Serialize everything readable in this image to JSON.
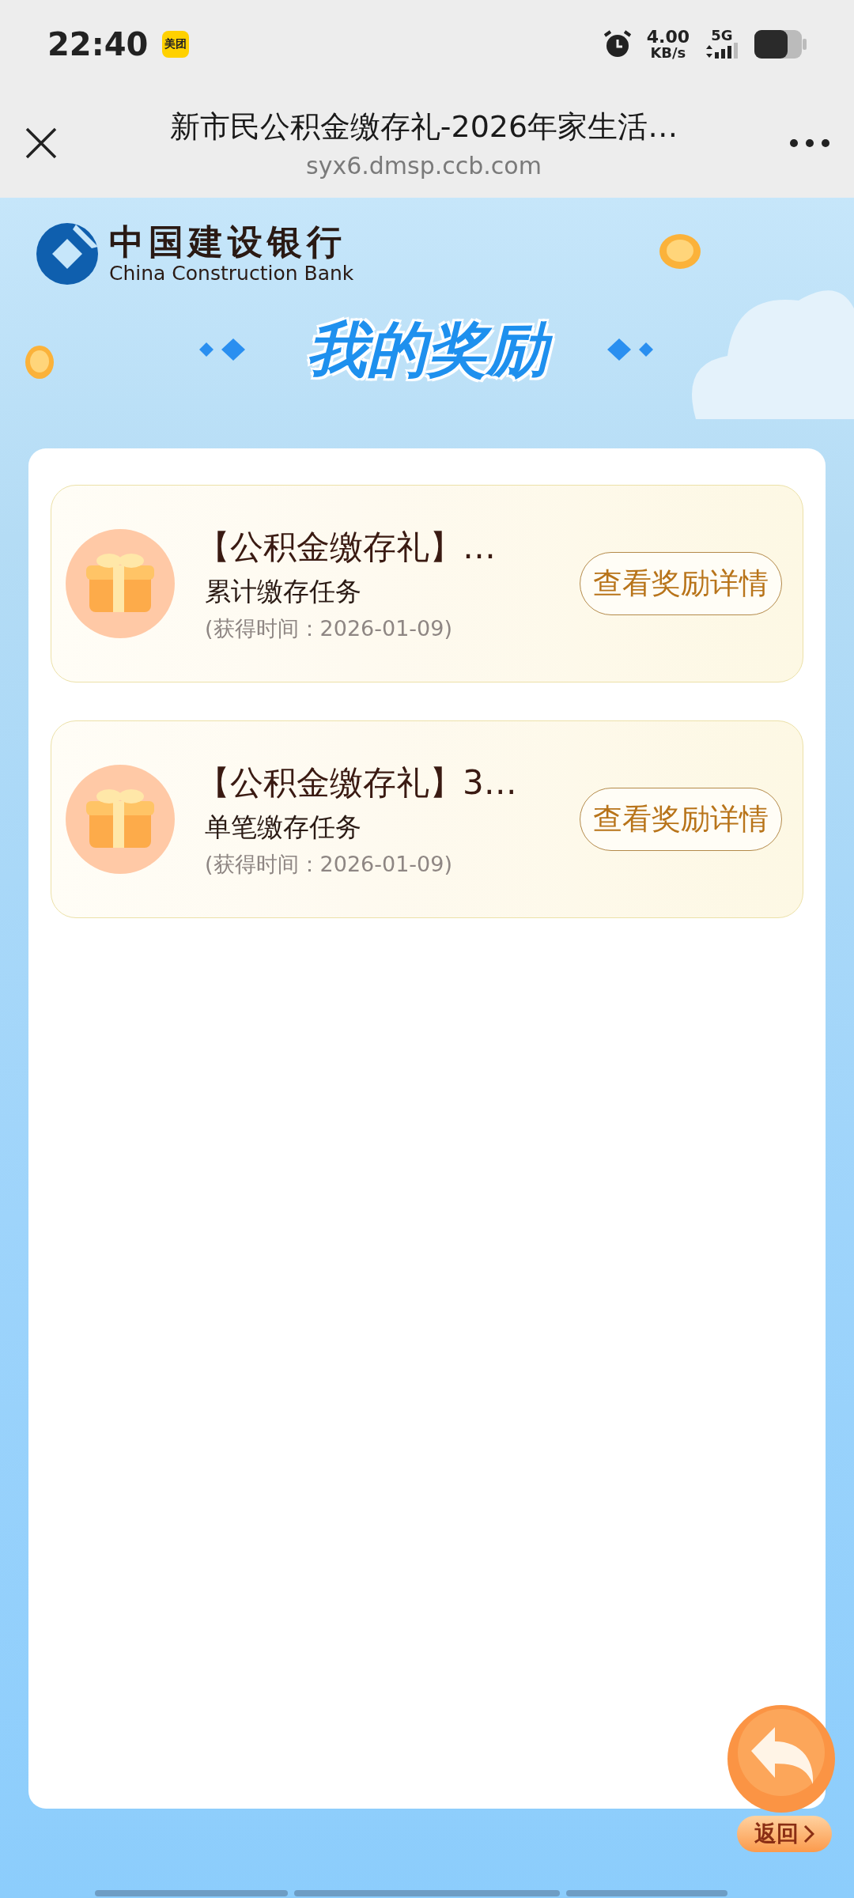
{
  "status_bar": {
    "time": "22:40",
    "app_badge": "美团",
    "speed_value": "4.00",
    "speed_unit": "KB/s",
    "network": "5G"
  },
  "browser_bar": {
    "title": "新市民公积金缴存礼-2026年家生活…",
    "url": "syx6.dmsp.ccb.com"
  },
  "brand": {
    "name_cn": "中国建设银行",
    "name_en": "China Construction Bank"
  },
  "page_title": "我的奖励",
  "rewards": [
    {
      "title": "【公积金缴存礼】…",
      "task": "累计缴存任务",
      "time": "(获得时间：2026-01-09)",
      "action": "查看奖励详情"
    },
    {
      "title": "【公积金缴存礼】3…",
      "task": "单笔缴存任务",
      "time": "(获得时间：2026-01-09)",
      "action": "查看奖励详情"
    }
  ],
  "back_button": {
    "label": "返回"
  }
}
